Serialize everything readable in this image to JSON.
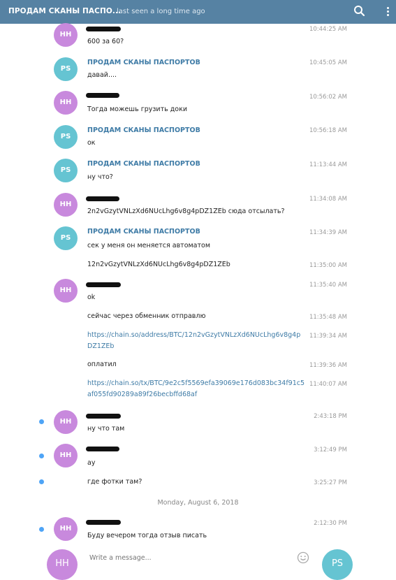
{
  "header": {
    "title": "ПРОДАМ СКАНЫ ПАСПО...",
    "status": "last seen a long time ago",
    "search_icon": "search-icon",
    "more_icon": "more-vertical-icon"
  },
  "avatars": {
    "hh": "HH",
    "ps": "PS"
  },
  "sender_ps": "ПРОДАМ СКАНЫ ПАСПОРТОВ",
  "messages": [
    {
      "text": "600 за 60?",
      "time": "10:44:25 AM"
    },
    {
      "text": "давай....",
      "time": "10:45:05 AM"
    },
    {
      "text": "Тогда можешь грузить доки",
      "time": "10:56:02 AM"
    },
    {
      "text": "ок",
      "time": "10:56:18 AM"
    },
    {
      "text": "ну что?",
      "time": "11:13:44 AM"
    },
    {
      "text": "2n2vGzytVNLzXd6NUcLhg6v8g4pDZ1ZEb сюда отсылать?",
      "time": "11:34:08 AM"
    },
    {
      "text": "сек у меня он меняется автоматом",
      "time": "11:34:39 AM"
    },
    {
      "text": "12n2vGzytVNLzXd6NUcLhg6v8g4pDZ1ZEb",
      "time": "11:35:00 AM"
    },
    {
      "text": "ok",
      "time": "11:35:40 AM"
    },
    {
      "text": "сейчас через обменник отправлю",
      "time": "11:35:48 AM"
    },
    {
      "text": "https://chain.so/address/BTC/12n2vGzytVNLzXd6NUcLhg6v8g4pDZ1ZEb",
      "time": "11:39:34 AM"
    },
    {
      "text": "оплатил",
      "time": "11:39:36 AM"
    },
    {
      "text": "https://chain.so/tx/BTC/9e2c5f5569efa39069e176d083bc34f91c5af055fd90289a89f26becbffd68af",
      "time": "11:40:07 AM"
    },
    {
      "text": "ну что там",
      "time": "2:43:18 PM"
    },
    {
      "text": "ау",
      "time": "3:12:49 PM"
    },
    {
      "text": "где фотки там?",
      "time": "3:25:27 PM"
    },
    {
      "text": "Буду вечером тогда отзыв писать",
      "time": "2:12:30 PM"
    }
  ],
  "date_separator": "Monday, August 6, 2018",
  "composer": {
    "placeholder": "Write a message...",
    "emoji_icon": "smile-icon",
    "left_avatar": "HH",
    "right_avatar": "PS"
  },
  "colors": {
    "header_bg": "#5682a3",
    "link": "#3e7ba6",
    "avatar_hh": "#c889dd",
    "avatar_ps": "#65c4d2",
    "unread_dot": "#4ea4f6"
  }
}
